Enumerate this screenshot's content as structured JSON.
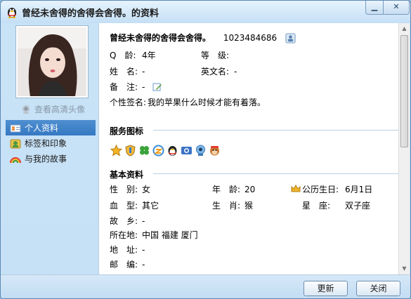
{
  "window": {
    "title": "曾经未舍得的舍得会舍得。的资料",
    "minimize_icon": "minimize-icon",
    "close_icon": "close-icon"
  },
  "sidebar": {
    "view_hd_avatar": "查看高清头像",
    "items": [
      {
        "label": "个人资料",
        "icon": "profile-card-icon",
        "active": true
      },
      {
        "label": "标签和印象",
        "icon": "tag-icon",
        "active": false
      },
      {
        "label": "与我的故事",
        "icon": "rainbow-icon",
        "active": false
      }
    ]
  },
  "profile": {
    "nickname": "曾经未舍得的舍得会舍得。",
    "qq_number": "1023484686",
    "fields": {
      "age_label": "Q　龄:",
      "age_value": "4年",
      "level_label": "等　级:",
      "name_label": "姓　名:",
      "name_value": "-",
      "english_name_label": "英文名:",
      "english_name_value": "-",
      "note_label": "备　注:",
      "note_value": "-",
      "signature_label": "个性签名:",
      "signature_value": "我的苹果什么时候才能有着落。"
    }
  },
  "services": {
    "title": "服务图标",
    "icons": [
      "star-icon",
      "shield-icon",
      "clover-icon",
      "qzone-icon",
      "penguin-icon",
      "camera-icon",
      "webcam-icon",
      "monkey-icon"
    ]
  },
  "basic": {
    "title": "基本资料",
    "gender_label": "性　别:",
    "gender_value": "女",
    "age_label": "年　龄:",
    "age_value": "20",
    "birthday_label": "公历生日:",
    "birthday_value": "6月1日",
    "blood_label": "血　型:",
    "blood_value": "其它",
    "zodiac_label": "生　肖:",
    "zodiac_value": "猴",
    "star_label": "星　座:",
    "star_value": "双子座",
    "hometown_label": "故　乡:",
    "hometown_value": "-",
    "location_label": "所在地:",
    "location_value": "中国 福建 厦门",
    "address_label": "地　址:",
    "address_value": "-",
    "postcode_label": "邮　编:",
    "postcode_value": "-"
  },
  "buttons": {
    "refresh": "更新",
    "close": "关闭"
  },
  "colors": {
    "accent": "#3a7dc4",
    "window_bg": "#c8e2f6",
    "section_line": "#b8cfe3"
  }
}
